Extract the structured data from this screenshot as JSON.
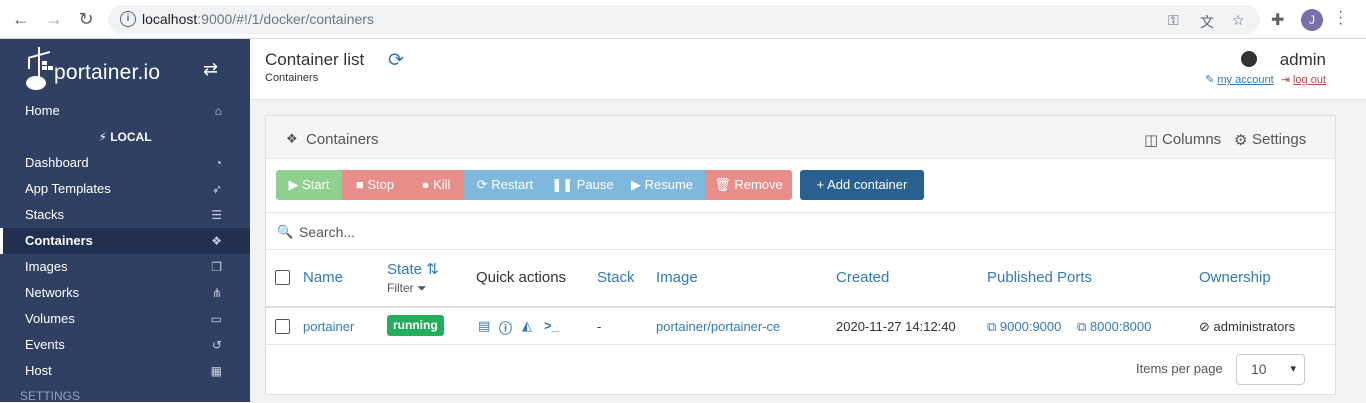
{
  "browser": {
    "url_host": "localhost",
    "url_rest": ":9000/#!/1/docker/containers",
    "profile_initial": "J"
  },
  "sidebar": {
    "brand": "portainer.io",
    "endpoint": "LOCAL",
    "items": [
      {
        "label": "Home",
        "icon": "home-icon",
        "glyph": "⌂"
      },
      {
        "label": "Dashboard",
        "icon": "tachometer-icon",
        "glyph": "◔"
      },
      {
        "label": "App Templates",
        "icon": "rocket-icon",
        "glyph": "➶"
      },
      {
        "label": "Stacks",
        "icon": "list-icon",
        "glyph": "☰"
      },
      {
        "label": "Containers",
        "icon": "cubes-icon",
        "glyph": "❖"
      },
      {
        "label": "Images",
        "icon": "clone-icon",
        "glyph": "❐"
      },
      {
        "label": "Networks",
        "icon": "sitemap-icon",
        "glyph": "⋔"
      },
      {
        "label": "Volumes",
        "icon": "hdd-icon",
        "glyph": "▭"
      },
      {
        "label": "Events",
        "icon": "history-icon",
        "glyph": "↺"
      },
      {
        "label": "Host",
        "icon": "th-icon",
        "glyph": "▦"
      }
    ],
    "settings_title": "SETTINGS"
  },
  "header": {
    "title": "Container list",
    "subtitle": "Containers",
    "user": "admin",
    "my_account": "my account",
    "log_out": "log out"
  },
  "panel": {
    "title": "Containers",
    "columns_label": "Columns",
    "settings_label": "Settings"
  },
  "actions": {
    "start": "Start",
    "stop": "Stop",
    "kill": "Kill",
    "restart": "Restart",
    "pause": "Pause",
    "resume": "Resume",
    "remove": "Remove",
    "add": "Add container"
  },
  "search": {
    "placeholder": "Search..."
  },
  "table": {
    "headers": {
      "name": "Name",
      "state": "State",
      "filter": "Filter",
      "quick_actions": "Quick actions",
      "stack": "Stack",
      "image": "Image",
      "created": "Created",
      "ports": "Published Ports",
      "ownership": "Ownership"
    },
    "rows": [
      {
        "name": "portainer",
        "state": "running",
        "stack": "-",
        "image": "portainer/portainer-ce",
        "created": "2020-11-27 14:12:40",
        "port1": "9000:9000",
        "port2": "8000:8000",
        "ownership": "administrators"
      }
    ]
  },
  "pagination": {
    "label": "Items per page",
    "value": "10"
  },
  "colors": {
    "sidebar_bg": "#2f4063",
    "link": "#337ab7",
    "running": "#23ad5c"
  }
}
